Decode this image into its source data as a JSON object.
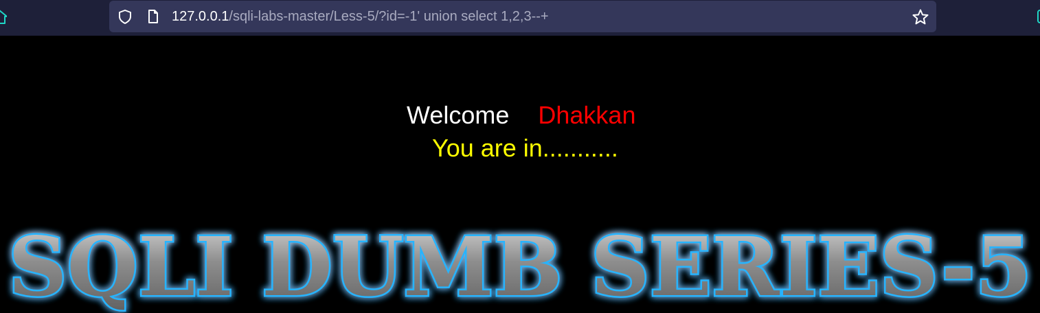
{
  "browser": {
    "url_host": "127.0.0.1",
    "url_path": "/sqli-labs-master/Less-5/?id=-1' union select 1,2,3--+",
    "icons": [
      "home-icon",
      "shield-icon",
      "page-icon",
      "star-icon"
    ]
  },
  "page": {
    "welcome_word": "Welcome",
    "welcome_name": "Dhakkan",
    "status_message": "You are in...........",
    "banner_title": "SQLI DUMB SERIES-5"
  },
  "colors": {
    "toolbar": "#1e2039",
    "urlbar": "#34375a",
    "page_background": "#000000",
    "welcome": "#ffffff",
    "name": "#ff0000",
    "status": "#ffff00",
    "banner_glow": "#1ea7ff",
    "banner_fill": "#9a9a9a"
  }
}
